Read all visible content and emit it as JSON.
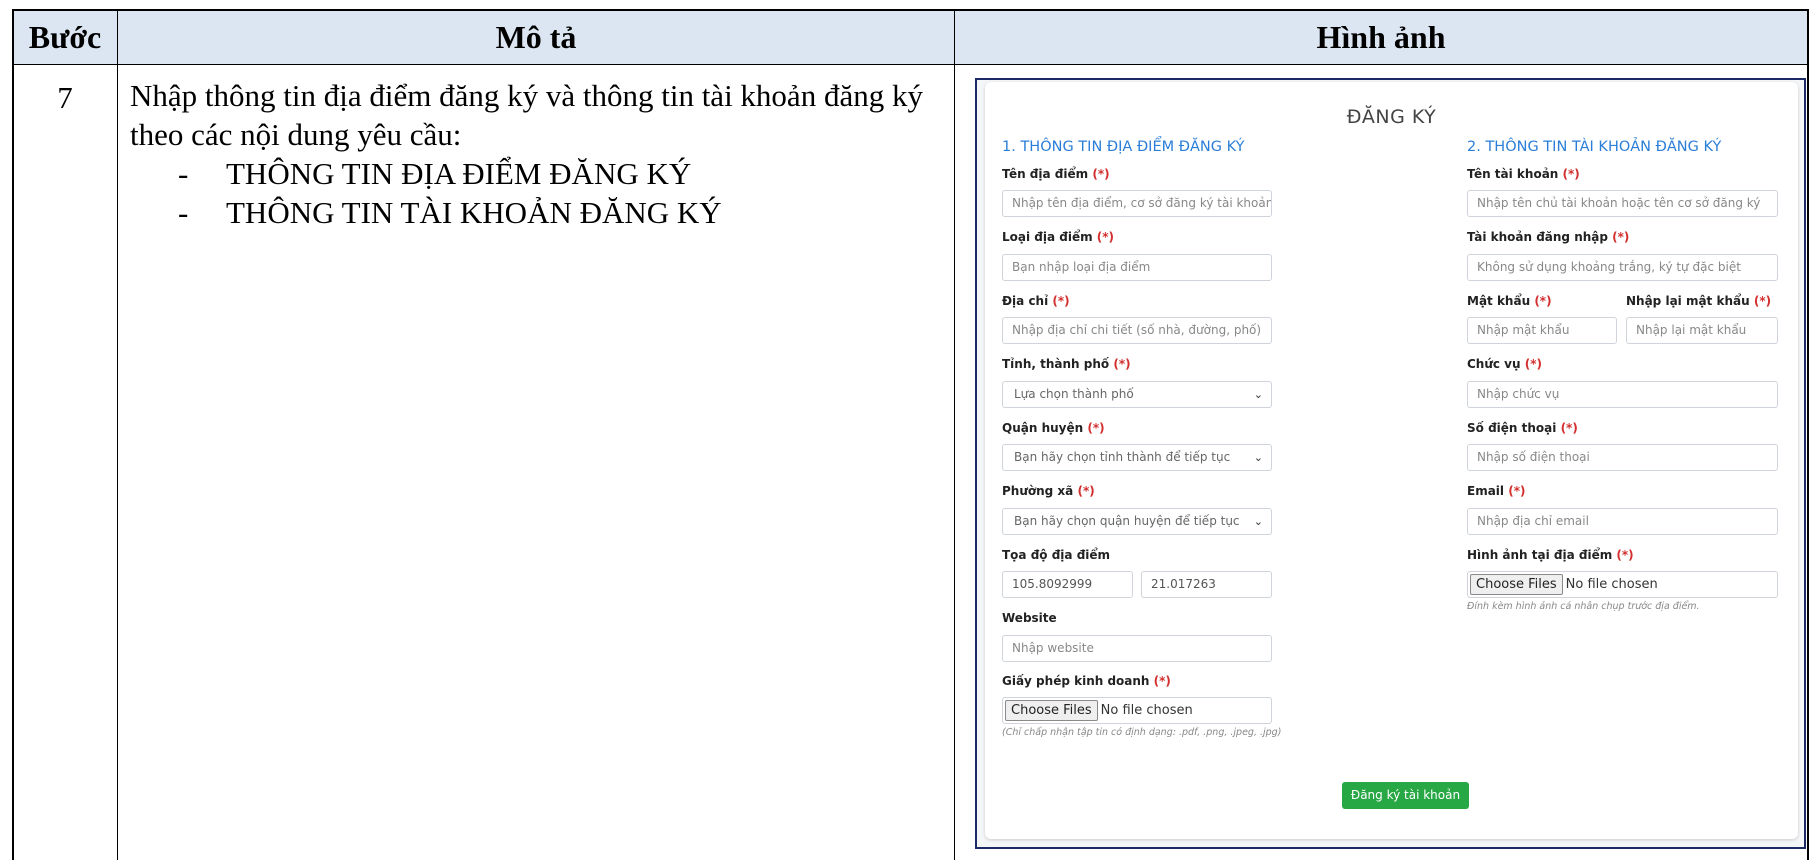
{
  "table": {
    "headers": {
      "step": "Bước",
      "description": "Mô tả",
      "image": "Hình ảnh"
    },
    "row": {
      "step": "7",
      "description": "Nhập thông tin địa điểm đăng ký và thông tin tài khoản đăng ký theo các nội dung yêu cầu:",
      "bullets": [
        {
          "dash": "-",
          "text": "THÔNG TIN ĐỊA ĐIỂM ĐĂNG KÝ"
        },
        {
          "dash": "-",
          "text": "THÔNG TIN TÀI KHOẢN ĐĂNG KÝ"
        }
      ]
    }
  },
  "form": {
    "title": "ĐĂNG KÝ",
    "required_mark": "(*)",
    "left": {
      "title": "1. THÔNG TIN ĐỊA ĐIỂM ĐĂNG KÝ",
      "place_name": {
        "label": "Tên địa điểm",
        "placeholder": "Nhập tên địa điểm, cơ sở đăng ký tài khoản"
      },
      "place_type": {
        "label": "Loại địa điểm",
        "placeholder": "Bạn nhập loại địa điểm"
      },
      "address": {
        "label": "Địa chỉ",
        "placeholder": "Nhập địa chỉ chi tiết (số nhà, đường, phố)"
      },
      "province": {
        "label": "Tỉnh, thành phố",
        "selected": "Lựa chọn thành phố"
      },
      "district": {
        "label": "Quận huyện",
        "selected": "Bạn hãy chọn tỉnh thành để tiếp tục"
      },
      "ward": {
        "label": "Phường xã",
        "selected": "Bạn hãy chọn quận huyện để tiếp tục"
      },
      "coords": {
        "label": "Tọa độ địa điểm",
        "longitude": "105.8092999",
        "latitude": "21.017263"
      },
      "website": {
        "label": "Website",
        "placeholder": "Nhập website"
      },
      "license": {
        "label": "Giấy phép kinh doanh",
        "button": "Choose Files",
        "status": "No file chosen",
        "hint": "(Chỉ chấp nhận tập tin có định dạng: .pdf, .png, .jpeg, .jpg)"
      }
    },
    "right": {
      "title": "2. THÔNG TIN TÀI KHOẢN ĐĂNG KÝ",
      "account_name": {
        "label": "Tên tài khoản",
        "placeholder": "Nhập tên chủ tài khoản hoặc tên cơ sở đăng ký"
      },
      "username": {
        "label": "Tài khoản đăng nhập",
        "placeholder": "Không sử dụng khoảng trắng, ký tự đặc biệt"
      },
      "password": {
        "label": "Mật khẩu",
        "placeholder": "Nhập mật khẩu"
      },
      "password_confirm": {
        "label": "Nhập lại mật khẩu",
        "placeholder": "Nhập lại mật khẩu"
      },
      "position": {
        "label": "Chức vụ",
        "placeholder": "Nhập chức vụ"
      },
      "phone": {
        "label": "Số điện thoại",
        "placeholder": "Nhập số điện thoại"
      },
      "email": {
        "label": "Email",
        "placeholder": "Nhập địa chỉ email"
      },
      "photo": {
        "label": "Hình ảnh tại địa điểm",
        "button": "Choose Files",
        "status": "No file chosen",
        "hint": "Đính kèm hình ảnh cá nhân chụp trước địa điểm."
      }
    },
    "submit": "Đăng ký tài khoản"
  }
}
